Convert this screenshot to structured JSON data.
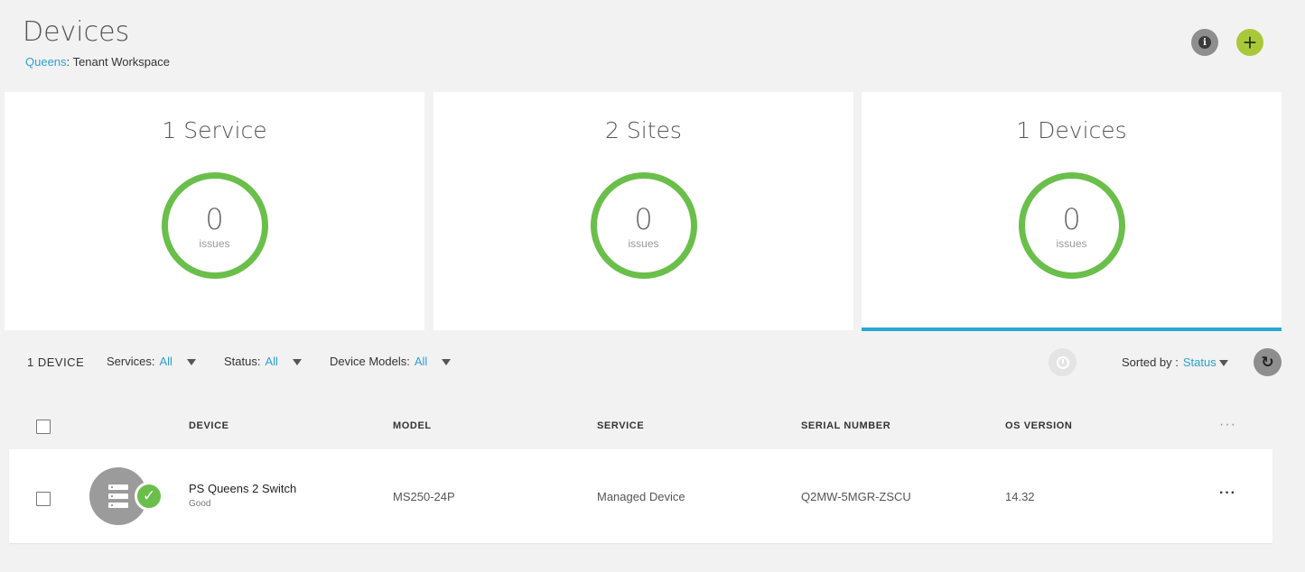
{
  "header": {
    "title": "Devices",
    "breadcrumb_link": "Queens",
    "breadcrumb_sep": ":",
    "breadcrumb_rest": "Tenant Workspace",
    "info_icon": "i",
    "add_icon": "+"
  },
  "cards": [
    {
      "title": "1 Service",
      "count": "0",
      "label": "issues",
      "status_color": "#6abf4b"
    },
    {
      "title": "2 Sites",
      "count": "0",
      "label": "issues",
      "status_color": "#6abf4b"
    },
    {
      "title": "1 Devices",
      "count": "0",
      "label": "issues",
      "status_color": "#6abf4b",
      "active": true,
      "active_color": "#2aa5d8"
    }
  ],
  "toolbar": {
    "device_count": "1 DEVICE",
    "filters": [
      {
        "label": "Services:",
        "value": "All"
      },
      {
        "label": "Status:",
        "value": "All"
      },
      {
        "label": "Device Models:",
        "value": "All"
      }
    ],
    "sorted_label": "Sorted by :",
    "sorted_value": "Status",
    "refresh_icon": "↻"
  },
  "table": {
    "columns": [
      "DEVICE",
      "MODEL",
      "SERVICE",
      "SERIAL NUMBER",
      "OS VERSION"
    ],
    "more_icon": "···",
    "rows": [
      {
        "name": "PS Queens 2 Switch",
        "health": "Good",
        "model": "MS250-24P",
        "service": "Managed Device",
        "serial": "Q2MW-5MGR-ZSCU",
        "os_version": "14.32",
        "status_icon": "✓",
        "more_icon": "···"
      }
    ]
  },
  "colors": {
    "accent": "#2f9fd6",
    "good": "#6abf4b",
    "add_button": "#a8c83a"
  },
  "icons": {
    "info": "info-icon",
    "add": "plus-icon",
    "timer": "timer-icon",
    "refresh": "refresh-icon",
    "device": "server-icon",
    "status": "checkmark-icon",
    "more": "more-dots-icon",
    "caret": "caret-down-icon"
  }
}
